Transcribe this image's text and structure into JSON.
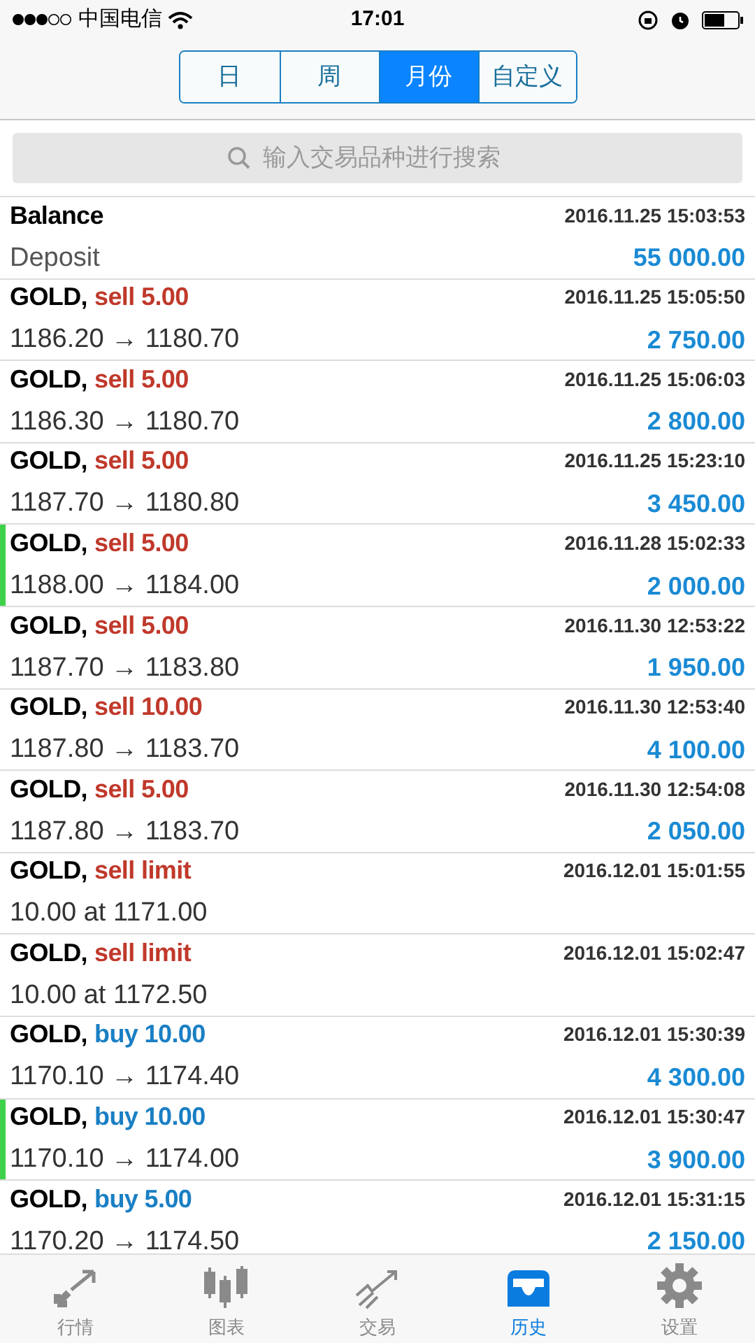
{
  "status_bar": {
    "carrier": "中国电信",
    "time": "17:01"
  },
  "tabs": [
    {
      "label": "日",
      "selected": false
    },
    {
      "label": "周",
      "selected": false
    },
    {
      "label": "月份",
      "selected": true
    },
    {
      "label": "自定义",
      "selected": false
    }
  ],
  "search": {
    "placeholder": "输入交易品种进行搜索"
  },
  "rows": [
    {
      "kind": "balance",
      "symbol": "Balance",
      "detail": "Deposit",
      "time": "2016.11.25 15:03:53",
      "amount": "55 000.00",
      "marked": false
    },
    {
      "kind": "sell",
      "symbol": "GOLD,",
      "action": "sell 5.00",
      "detail": "1186.20 → 1180.70",
      "time": "2016.11.25 15:05:50",
      "amount": "2 750.00",
      "marked": false
    },
    {
      "kind": "sell",
      "symbol": "GOLD,",
      "action": "sell 5.00",
      "detail": "1186.30 → 1180.70",
      "time": "2016.11.25 15:06:03",
      "amount": "2 800.00",
      "marked": false
    },
    {
      "kind": "sell",
      "symbol": "GOLD,",
      "action": "sell 5.00",
      "detail": "1187.70 → 1180.80",
      "time": "2016.11.25 15:23:10",
      "amount": "3 450.00",
      "marked": false
    },
    {
      "kind": "sell",
      "symbol": "GOLD,",
      "action": "sell 5.00",
      "detail": "1188.00 → 1184.00",
      "time": "2016.11.28 15:02:33",
      "amount": "2 000.00",
      "marked": true
    },
    {
      "kind": "sell",
      "symbol": "GOLD,",
      "action": "sell 5.00",
      "detail": "1187.70 → 1183.80",
      "time": "2016.11.30 12:53:22",
      "amount": "1 950.00",
      "marked": false
    },
    {
      "kind": "sell",
      "symbol": "GOLD,",
      "action": "sell 10.00",
      "detail": "1187.80 → 1183.70",
      "time": "2016.11.30 12:53:40",
      "amount": "4 100.00",
      "marked": false
    },
    {
      "kind": "sell",
      "symbol": "GOLD,",
      "action": "sell 5.00",
      "detail": "1187.80 → 1183.70",
      "time": "2016.11.30 12:54:08",
      "amount": "2 050.00",
      "marked": false
    },
    {
      "kind": "sell",
      "symbol": "GOLD,",
      "action": "sell limit",
      "detail": "10.00 at 1171.00",
      "time": "2016.12.01 15:01:55",
      "marked": false
    },
    {
      "kind": "sell",
      "symbol": "GOLD,",
      "action": "sell limit",
      "detail": "10.00 at 1172.50",
      "time": "2016.12.01 15:02:47",
      "marked": false
    },
    {
      "kind": "buy",
      "symbol": "GOLD,",
      "action": "buy 10.00",
      "detail": "1170.10 → 1174.40",
      "time": "2016.12.01 15:30:39",
      "amount": "4 300.00",
      "marked": false
    },
    {
      "kind": "buy",
      "symbol": "GOLD,",
      "action": "buy 10.00",
      "detail": "1170.10 → 1174.00",
      "time": "2016.12.01 15:30:47",
      "amount": "3 900.00",
      "marked": true
    },
    {
      "kind": "buy",
      "symbol": "GOLD,",
      "action": "buy 5.00",
      "detail": "1170.20 → 1174.50",
      "time": "2016.12.01 15:31:15",
      "amount": "2 150.00",
      "marked": false
    }
  ],
  "tab_bar": [
    {
      "kind": "quotes",
      "label": "行情",
      "selected": false
    },
    {
      "kind": "chart",
      "label": "图表",
      "selected": false
    },
    {
      "kind": "trade",
      "label": "交易",
      "selected": false
    },
    {
      "kind": "history",
      "label": "历史",
      "selected": true
    },
    {
      "kind": "settings",
      "label": "设置",
      "selected": false
    }
  ]
}
